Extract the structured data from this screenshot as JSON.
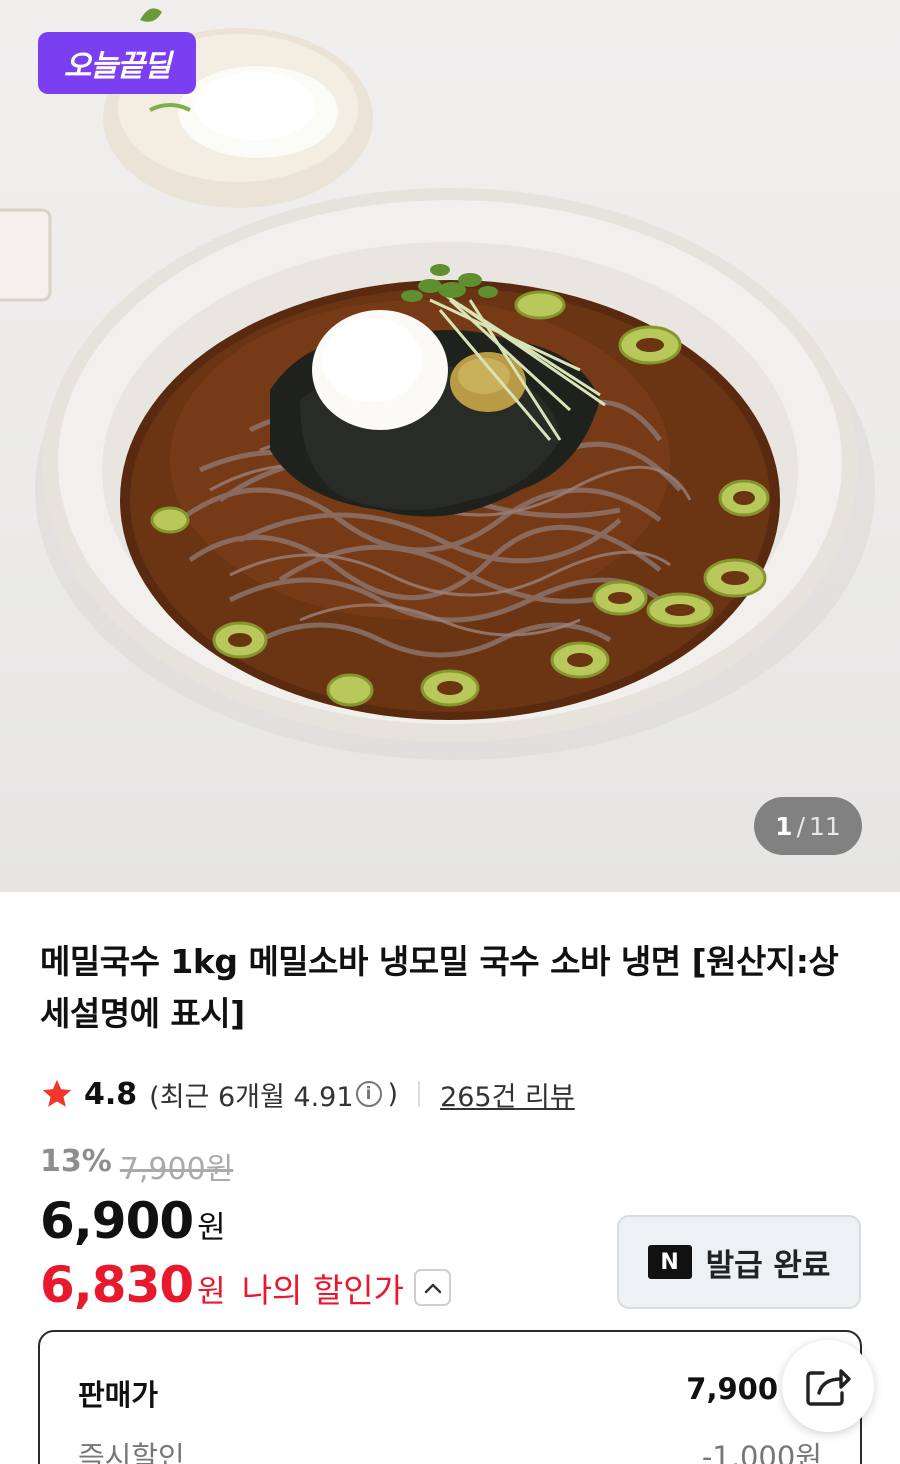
{
  "hero": {
    "badge": "오늘끝딜",
    "counter_current": "1",
    "counter_sep": "/",
    "counter_total": "11"
  },
  "product": {
    "title": "메밀국수 1kg 메밀소바 냉모밀 국수 소바 냉면 [원산지:상세설명에 표시]",
    "rating": "4.8",
    "recent_rating_text": "(최근 6개월 4.91",
    "recent_rating_close": ")",
    "reviews": "265건 리뷰"
  },
  "pricing": {
    "discount_pct": "13%",
    "original_price": "7,900원",
    "price": "6,900",
    "price_unit": "원",
    "my_price": "6,830",
    "my_price_unit": "원",
    "my_price_label": "나의 할인가"
  },
  "coupon": {
    "icon_letter": "N",
    "label": "발급 완료"
  },
  "breakdown": {
    "rows": [
      {
        "label": "판매가",
        "value": "7,900"
      },
      {
        "label": "즉시할인",
        "value": "-1,000원"
      }
    ]
  },
  "colors": {
    "accent_purple": "#7b3ff2",
    "sale_red": "#e8192c",
    "star": "#f0372b"
  },
  "icons": {
    "star": "star-icon",
    "info": "info-icon",
    "chevron": "chevron-up-icon",
    "share": "share-icon",
    "naver": "naver-n-icon"
  }
}
